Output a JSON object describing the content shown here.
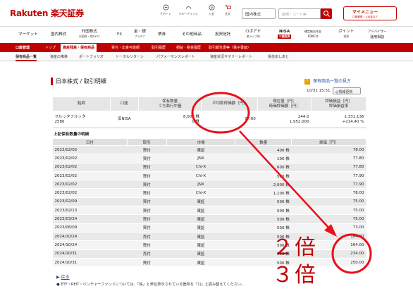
{
  "header": {
    "logo": "Rakuten 楽天証券",
    "icons": [
      {
        "name": "support",
        "label": "サポート"
      },
      {
        "name": "money-bridge",
        "label": "マネーブリッジ"
      },
      {
        "name": "deposit",
        "label": "入金"
      },
      {
        "name": "cart",
        "label": "注文"
      }
    ],
    "search_select": "国内株式",
    "search_placeholder": "銘柄・コード等",
    "mymenu_label": "マイメニュー",
    "mymenu_sub": "口座管理・入出金など"
  },
  "nav": [
    {
      "label": "マーケット",
      "sub": ""
    },
    {
      "label": "国内株式",
      "sub": ""
    },
    {
      "label": "外国株式",
      "sub": "米国株・海外ETF"
    },
    {
      "label": "FX",
      "sub": ""
    },
    {
      "label": "金・銀",
      "sub": "プラチナ"
    },
    {
      "label": "債券",
      "sub": ""
    },
    {
      "label": "その他商品",
      "sub": ""
    },
    {
      "label": "投資信託",
      "sub": ""
    },
    {
      "label": "ロボアド",
      "sub": "楽ラップ他"
    },
    {
      "label": "NISA",
      "sub": "少額投資"
    },
    {
      "label": "確定拠出年金",
      "sub": "iDeCo"
    },
    {
      "label": "ポイント",
      "sub": "投資"
    },
    {
      "label": "アドバイザー",
      "sub": "運用相談"
    }
  ],
  "redbar": [
    {
      "label": "口座管理",
      "active": false
    },
    {
      "label": "トップ",
      "active": false
    },
    {
      "label": "資産残高・保有商品",
      "active": true
    },
    {
      "label": "買付・出金可能額",
      "active": false
    },
    {
      "label": "取引履歴",
      "active": false
    },
    {
      "label": "損益・税金履歴",
      "active": false
    },
    {
      "label": "取引報告書等（電子書面）",
      "active": false
    }
  ],
  "subnav": [
    {
      "label": "保有商品一覧",
      "active": true
    },
    {
      "label": "資産の推移",
      "active": false
    },
    {
      "label": "ポートフォリオ",
      "active": false
    },
    {
      "label": "トータルリターン",
      "active": false
    },
    {
      "label": "パフォーマンスレポート",
      "active": false
    },
    {
      "label": "資産状況サマリーレポート",
      "active": false
    },
    {
      "label": "投信あしあと",
      "active": false
    }
  ],
  "page": {
    "title": "日本株式 / 取引明細",
    "help_link": "保有商品一覧の見方",
    "help_icon": "?",
    "timestamp": "10/31 15:51",
    "refresh": "情報更新",
    "details_heading": "上記保有数量の明細",
    "back": "戻る",
    "note": "ETF・REIT・ベンチャーファンドについては、「株」と単位表示されている箇所を「口」と読み替えてください。"
  },
  "summary": {
    "headers": [
      "銘柄",
      "口座",
      "保有数量\nうち執行中量",
      "平均取得価額［円］",
      "現在値［円］\n時価評価額［円］",
      "評価損益［円］\n評価損益率"
    ],
    "row": {
      "name": "フルッタフルッタ",
      "code": "2586",
      "account": "旧NISA",
      "qty": "8,000 株",
      "qty_exec": "0 株",
      "avg_price": "77.60",
      "price": "244.0",
      "market_value": "1,952,000",
      "pl": "1,331,136",
      "pl_rate": "+214.40 %"
    }
  },
  "details": {
    "headers": [
      "日付",
      "取引",
      "市場",
      "数量",
      "単価［円］"
    ],
    "rows": [
      [
        "2023/02/02",
        "買付",
        "東証",
        "400 株",
        "78.00"
      ],
      [
        "2023/02/02",
        "買付",
        "JNX",
        "100 株",
        "77.80"
      ],
      [
        "2023/02/02",
        "買付",
        "Chi-X",
        "600 株",
        "77.80"
      ],
      [
        "2023/02/02",
        "買付",
        "Chi-X",
        "500 株",
        "77.90"
      ],
      [
        "2023/02/02",
        "買付",
        "JNX",
        "2,000 株",
        "77.90"
      ],
      [
        "2023/02/02",
        "買付",
        "Chi-X",
        "1,100 株",
        "78.00"
      ],
      [
        "2023/02/09",
        "買付",
        "東証",
        "500 株",
        "75.00"
      ],
      [
        "2023/02/13",
        "買付",
        "東証",
        "500 株",
        "75.00"
      ],
      [
        "2023/03/24",
        "買付",
        "東証",
        "500 株",
        "75.00"
      ],
      [
        "2023/06/09",
        "買付",
        "東証",
        "500 株",
        "73.00"
      ],
      [
        "2024/10/24",
        "売付",
        "東証",
        "500 株",
        "164.00"
      ],
      [
        "2024/10/24",
        "買付",
        "東証",
        "500 株",
        "164.00"
      ],
      [
        "2024/10/31",
        "売付",
        "東証",
        "500 株",
        "234.00"
      ],
      [
        "2024/10/31",
        "買付",
        "東証",
        "500 株",
        "250.00"
      ]
    ]
  },
  "annotations": {
    "label_2x": "２倍",
    "label_3x": "３倍",
    "color": "#e8101a"
  }
}
